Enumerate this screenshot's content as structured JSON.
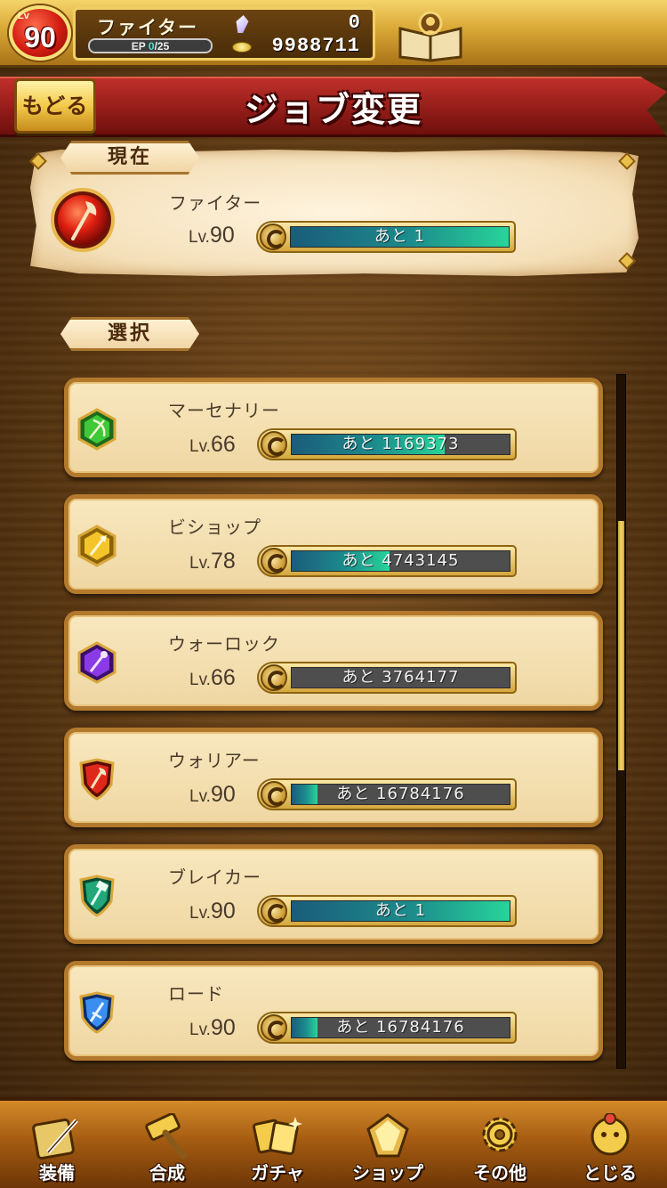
{
  "hud": {
    "level_tag": "Lv",
    "level": "90",
    "job_name": "ファイター",
    "ep_label": "EP ",
    "ep_current": "0",
    "ep_max": "/25",
    "gems": "0",
    "gold": "9988711"
  },
  "header": {
    "back_label": "もどる",
    "title": "ジョブ変更"
  },
  "current": {
    "section_label": "現在",
    "job": {
      "name": "ファイター",
      "lv_prefix": "Lv.",
      "level": "90",
      "remaining": "あと 1",
      "progress": 1.0,
      "icon": "red-axe-icon"
    }
  },
  "select": {
    "section_label": "選択",
    "jobs": [
      {
        "name": "マーセナリー",
        "lv_prefix": "Lv.",
        "level": "66",
        "remaining": "あと 1169373",
        "progress": 0.7,
        "icon": "green-bow-icon",
        "color": "#2fae3a"
      },
      {
        "name": "ビショップ",
        "lv_prefix": "Lv.",
        "level": "78",
        "remaining": "あと 4743145",
        "progress": 0.45,
        "icon": "yellow-staff-icon",
        "color": "#e9b81c"
      },
      {
        "name": "ウォーロック",
        "lv_prefix": "Lv.",
        "level": "66",
        "remaining": "あと 3764177",
        "progress": 0.0,
        "icon": "purple-wand-icon",
        "color": "#7a2bd6"
      },
      {
        "name": "ウォリアー",
        "lv_prefix": "Lv.",
        "level": "90",
        "remaining": "あと 16784176",
        "progress": 0.12,
        "icon": "red-axe-shield-icon",
        "color": "#d8271d"
      },
      {
        "name": "ブレイカー",
        "lv_prefix": "Lv.",
        "level": "90",
        "remaining": "あと 1",
        "progress": 1.0,
        "icon": "green-hammer-shield-icon",
        "color": "#1f9a6a"
      },
      {
        "name": "ロード",
        "lv_prefix": "Lv.",
        "level": "90",
        "remaining": "あと 16784176",
        "progress": 0.12,
        "icon": "blue-sword-shield-icon",
        "color": "#2a7ae2"
      }
    ]
  },
  "scroll": {
    "position": 0.33,
    "visible_fraction": 0.36
  },
  "nav": {
    "items": [
      {
        "label": "装備",
        "icon": "equipment-icon"
      },
      {
        "label": "合成",
        "icon": "hammer-icon"
      },
      {
        "label": "ガチャ",
        "icon": "gacha-cards-icon"
      },
      {
        "label": "ショップ",
        "icon": "shop-crystal-icon"
      },
      {
        "label": "その他",
        "icon": "gear-icon"
      },
      {
        "label": "とじる",
        "icon": "close-moogle-icon"
      }
    ]
  }
}
